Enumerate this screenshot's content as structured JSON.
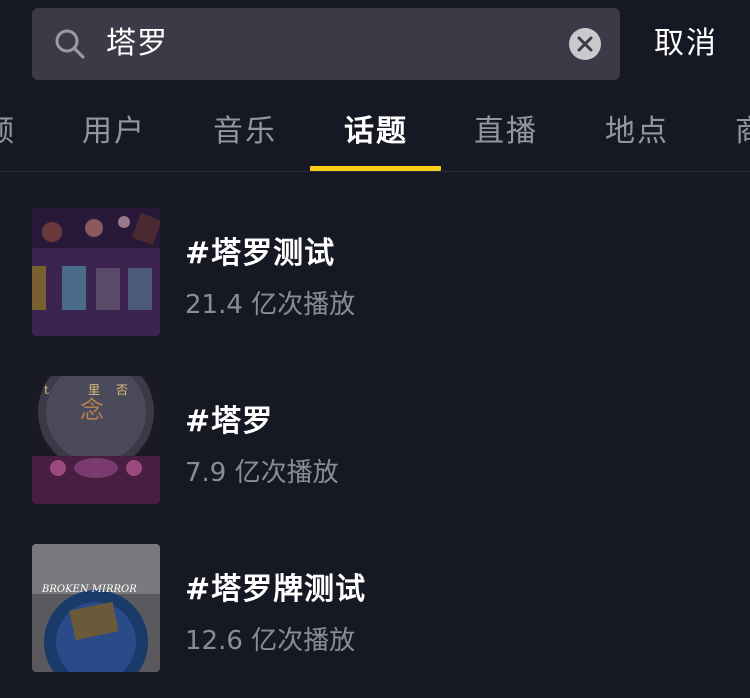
{
  "search": {
    "query": "塔罗",
    "cancel_label": "取消"
  },
  "tabs": [
    {
      "label": "频"
    },
    {
      "label": "用户"
    },
    {
      "label": "音乐"
    },
    {
      "label": "话题"
    },
    {
      "label": "直播"
    },
    {
      "label": "地点"
    },
    {
      "label": "商"
    }
  ],
  "active_tab": "话题",
  "topics": [
    {
      "title": "#塔罗测试",
      "plays": "21.4 亿次播放"
    },
    {
      "title": "#塔罗",
      "plays": "7.9 亿次播放"
    },
    {
      "title": "#塔罗牌测试",
      "plays": "12.6 亿次播放"
    }
  ],
  "thumbnail_text": {
    "topic_2": [
      "t",
      "里",
      "否",
      "念"
    ],
    "topic_3": [
      "BROKEN MIRROR"
    ]
  },
  "colors": {
    "background": "#161823",
    "search_box": "#3a3b46",
    "accent_underline": "#face15"
  }
}
